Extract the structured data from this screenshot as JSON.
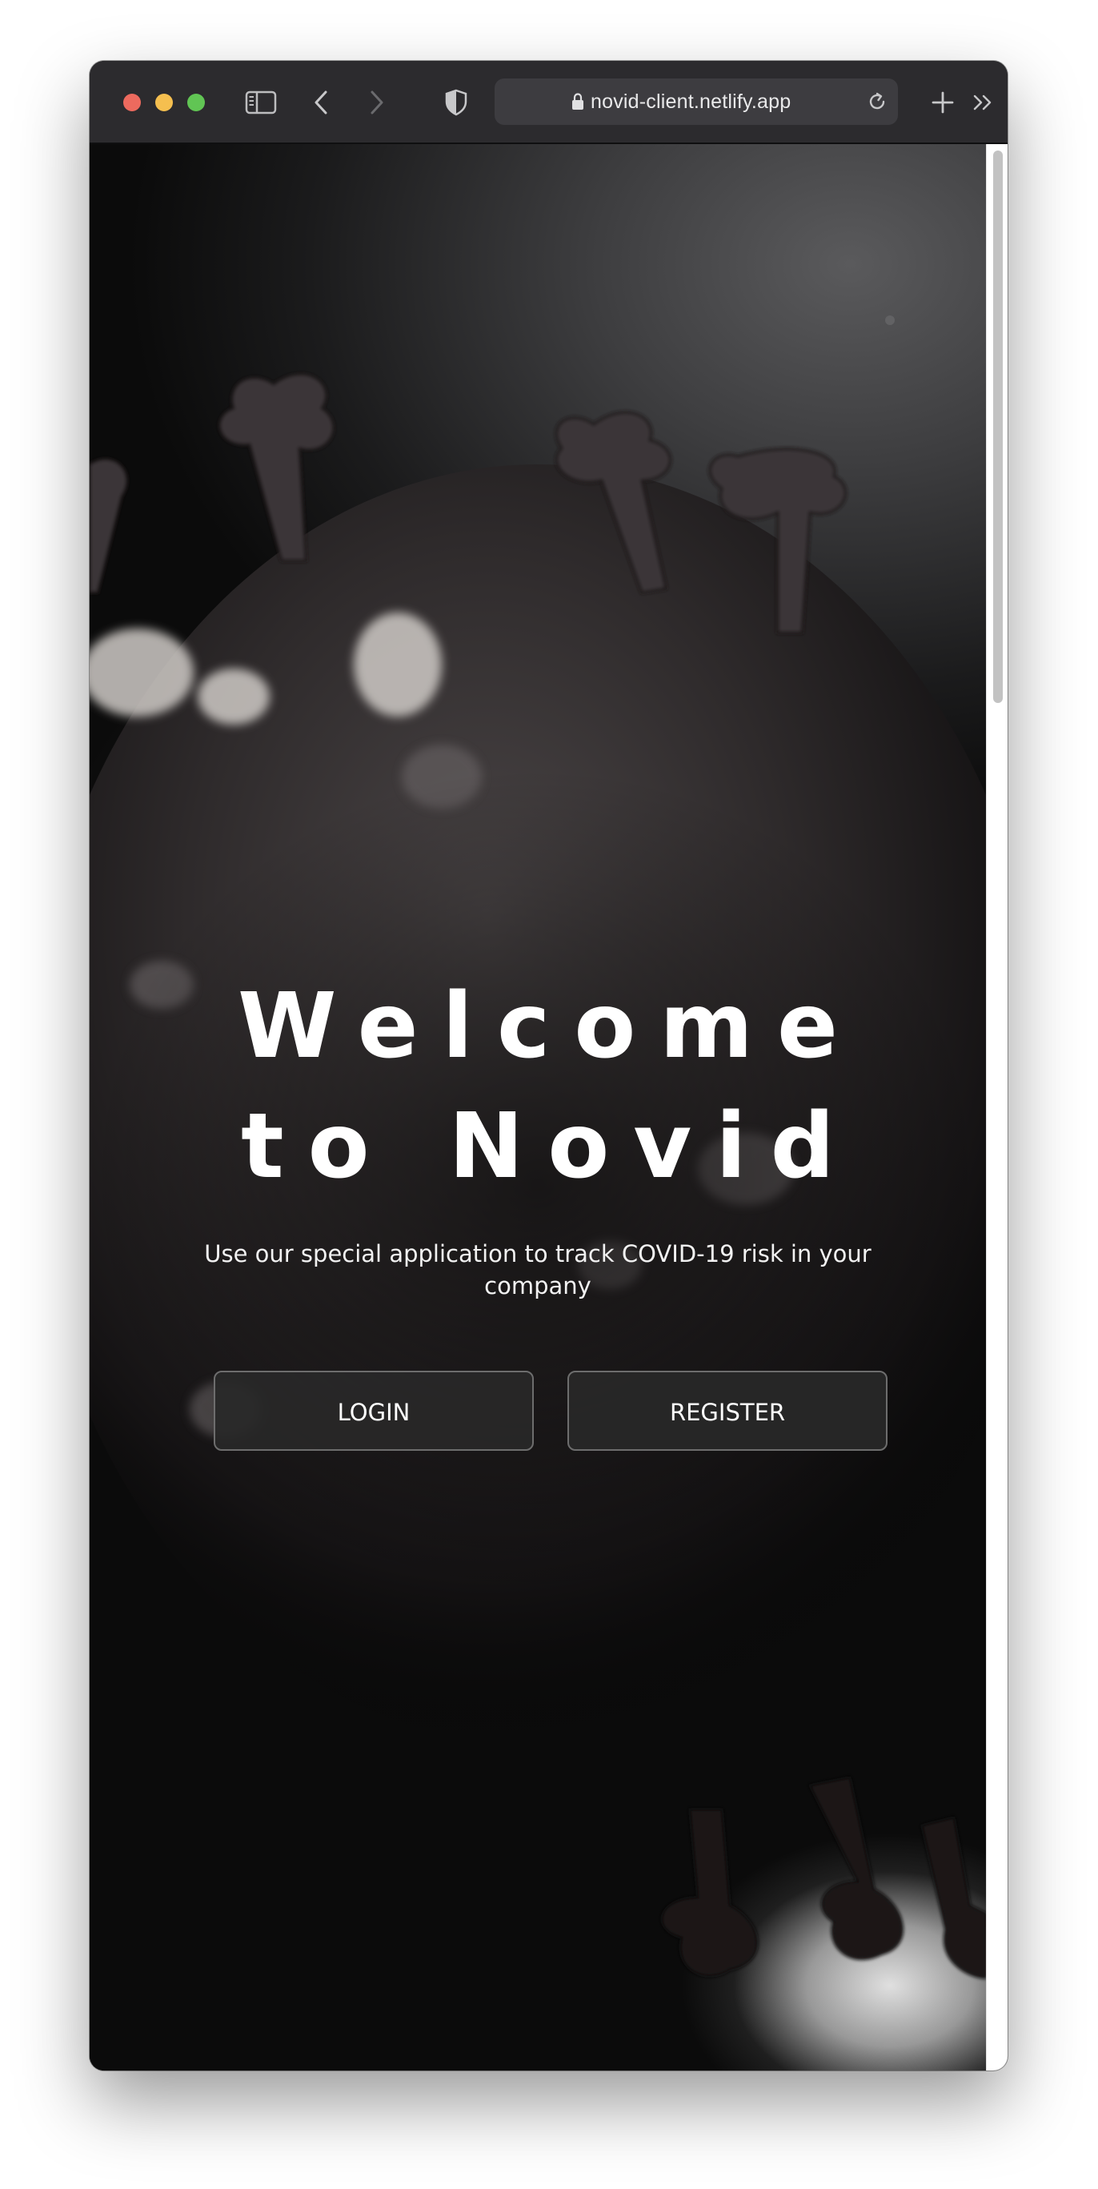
{
  "browser": {
    "url": "novid-client.netlify.app",
    "icons": {
      "sidebar": "sidebar-icon",
      "back": "chevron-left-icon",
      "forward": "chevron-right-icon",
      "privacy": "shield-icon",
      "lock": "lock-icon",
      "reload": "reload-icon",
      "new_tab": "plus-icon",
      "more": "double-chevron-right-icon"
    }
  },
  "page": {
    "title_line1": "Welcome",
    "title_line2": "to Novid",
    "subtitle": "Use our special application to track COVID-19 risk in your company",
    "buttons": {
      "login": "LOGIN",
      "register": "REGISTER"
    }
  },
  "colors": {
    "toolbar": "#2c2b2e",
    "address_bar": "#3d3c40",
    "button_bg": "#282828",
    "button_border": "#6d6d6d",
    "text": "#ffffff"
  }
}
